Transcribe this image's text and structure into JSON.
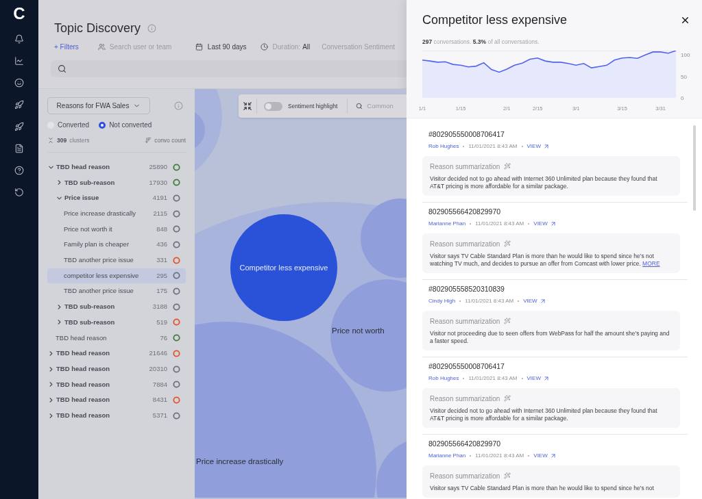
{
  "nav": {
    "logo": "C"
  },
  "header": {
    "title": "Topic Discovery"
  },
  "filters": {
    "add_filter": "+ Filters",
    "user_search": {
      "placeholder": "Search user or team"
    },
    "date_range": "Last 90 days",
    "duration": {
      "label": "Duration:",
      "value": "All"
    },
    "sentiment": "Conversation Sentiment"
  },
  "left_panel": {
    "dropdown": "Reasons for FWA Sales",
    "radios": [
      {
        "label": "Converted",
        "selected": false
      },
      {
        "label": "Not converted",
        "selected": true
      }
    ],
    "cluster_count": "309",
    "cluster_unit": "clusters",
    "sort": "convo count",
    "tree": [
      {
        "label": "TBD head reason",
        "count": "25890",
        "color": "#3f7d3a",
        "kind": "group",
        "expanded": true,
        "selected": false,
        "children": [
          {
            "label": "TBD sub-reason",
            "count": "17930",
            "color": "#3f7d3a",
            "kind": "group",
            "expanded": false,
            "selected": false
          },
          {
            "label": "Price issue",
            "count": "4191",
            "color": "#6b7280",
            "kind": "group",
            "expanded": true,
            "selected": false,
            "children": [
              {
                "label": "Price increase drastically",
                "count": "2115",
                "color": "#6b7280",
                "kind": "leaf",
                "selected": false
              },
              {
                "label": "Price not worth it",
                "count": "848",
                "color": "#6b7280",
                "kind": "leaf",
                "selected": false
              },
              {
                "label": "Family plan is cheaper",
                "count": "436",
                "color": "#6b7280",
                "kind": "leaf",
                "selected": false
              },
              {
                "label": "TBD another price issue",
                "count": "331",
                "color": "#e5532d",
                "kind": "leaf",
                "selected": false
              },
              {
                "label": "competitor less expensive",
                "count": "295",
                "color": "#6b7280",
                "kind": "leaf",
                "selected": true
              },
              {
                "label": "TBD another price issue",
                "count": "175",
                "color": "#6b7280",
                "kind": "leaf",
                "selected": false
              }
            ]
          },
          {
            "label": "TBD sub-reason",
            "count": "3188",
            "color": "#6b7280",
            "kind": "group",
            "expanded": false,
            "selected": false
          },
          {
            "label": "TBD sub-reason",
            "count": "519",
            "color": "#e5532d",
            "kind": "group",
            "expanded": false,
            "selected": false
          }
        ]
      },
      {
        "label": "TBD head reason",
        "count": "76",
        "color": "#3f7d3a",
        "kind": "leaf",
        "selected": false
      },
      {
        "label": "TBD head reason",
        "count": "21646",
        "color": "#e5532d",
        "kind": "group",
        "expanded": false,
        "selected": false
      },
      {
        "label": "TBD head reason",
        "count": "20310",
        "color": "#6b7280",
        "kind": "group",
        "expanded": false,
        "selected": false
      },
      {
        "label": "TBD head reason",
        "count": "7884",
        "color": "#6b7280",
        "kind": "group",
        "expanded": false,
        "selected": false
      },
      {
        "label": "TBD head reason",
        "count": "8431",
        "color": "#e5532d",
        "kind": "group",
        "expanded": false,
        "selected": false
      },
      {
        "label": "TBD head reason",
        "count": "5371",
        "color": "#6b7280",
        "kind": "group",
        "expanded": false,
        "selected": false
      }
    ]
  },
  "canvas": {
    "toolbar": {
      "sentiment_toggle": {
        "label": "Sentiment highlight",
        "on": false
      },
      "search": {
        "placeholder": "Common"
      }
    },
    "bubbles": [
      {
        "label": "Competitor less expensive",
        "selected": true
      },
      {
        "label": "Price not worth",
        "selected": false
      },
      {
        "label": "Price increase drastically",
        "selected": false
      }
    ]
  },
  "detail": {
    "title": "Competitor less expensive",
    "stats": "**297** conversations. **5.3%** of all conversations.",
    "chart_data": {
      "type": "area",
      "categories": [
        "1/1",
        null,
        null,
        null,
        null,
        "1/15",
        null,
        null,
        null,
        null,
        null,
        "2/1",
        null,
        null,
        null,
        "2/15",
        null,
        null,
        null,
        null,
        "3/1",
        null,
        null,
        null,
        null,
        null,
        "3/15",
        null,
        null,
        null,
        null,
        "3/31",
        null,
        null
      ],
      "series": [
        {
          "color": "#4f63f0",
          "values": [
            88,
            86,
            83,
            84,
            78,
            76,
            72,
            74,
            82,
            66,
            60,
            67,
            76,
            81,
            90,
            93,
            86,
            83,
            83,
            80,
            76,
            80,
            70,
            73,
            76,
            88,
            93,
            94,
            92,
            100,
            107,
            107,
            104,
            110
          ]
        }
      ],
      "ylim": [
        0,
        110
      ],
      "yticks": [
        0,
        50,
        100
      ]
    },
    "cards": [
      {
        "id": "#802905550008706417",
        "agent": "Rob Hughes",
        "time": "11/01/2021 8:43 AM",
        "view": "VIEW",
        "heading": "Reason summarization",
        "summary": "Visitor decided not to go ahead with Internet 360 Unlimited plan because they found that AT&T pricing is more affordable for a similar package."
      },
      {
        "id": "802905566420829970",
        "agent": "Marianne Phan",
        "time": "11/01/2021 8:43 AM",
        "view": "VIEW",
        "heading": "Reason summarization",
        "summary": "Visitor says TV Cable Standard Plan is more than he would like to spend since he's not watching TV much, and decides to pursue an offer from Comcast with lower price.",
        "more": "MORE"
      },
      {
        "id": "#802905558520310839",
        "agent": "Cindy High",
        "time": "11/01/2021 8:43 AM",
        "view": "VIEW",
        "heading": "Reason summarization",
        "summary": "Visitor not proceeding due to seen offers from WebPass for half the amount she's paying and a faster speed."
      },
      {
        "id": "#802905550008706417",
        "agent": "Rob Hughes",
        "time": "11/01/2021 8:43 AM",
        "view": "VIEW",
        "heading": "Reason summarization",
        "summary": "Visitor decided not to go ahead with Internet 360 Unlimited plan because they found that AT&T pricing is more affordable for a similar package."
      },
      {
        "id": "802905566420829970",
        "agent": "Marianne Phan",
        "time": "11/01/2021 8:43 AM",
        "view": "VIEW",
        "heading": "Reason summarization",
        "summary": "Visitor says TV Cable Standard Plan is more than he would like to spend since he's not"
      }
    ]
  }
}
